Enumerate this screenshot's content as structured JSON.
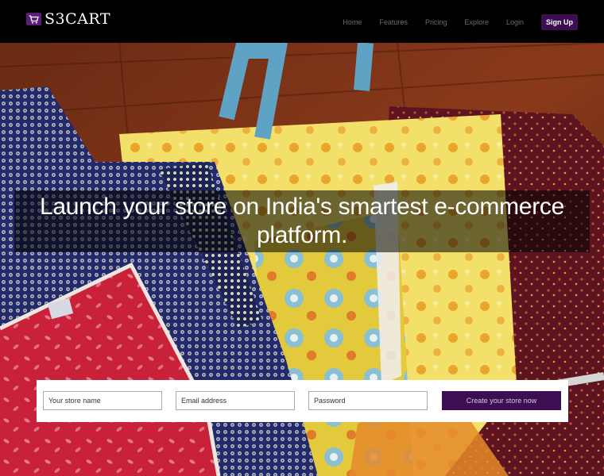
{
  "brand": {
    "name": "S3CART",
    "icon": "cart-icon",
    "accent": "#5b1d7a"
  },
  "nav": {
    "items": [
      {
        "label": "Home"
      },
      {
        "label": "Features"
      },
      {
        "label": "Pricing"
      },
      {
        "label": "Explore"
      },
      {
        "label": "Login"
      }
    ],
    "signup_label": "Sign Up",
    "signup_color": "#3d0f52"
  },
  "hero": {
    "headline": "Launch your store on India's smartest e-commerce platform."
  },
  "signup_form": {
    "store_name_placeholder": "Your store name",
    "email_placeholder": "Email address",
    "password_placeholder": "Password",
    "submit_label": "Create your store now"
  }
}
